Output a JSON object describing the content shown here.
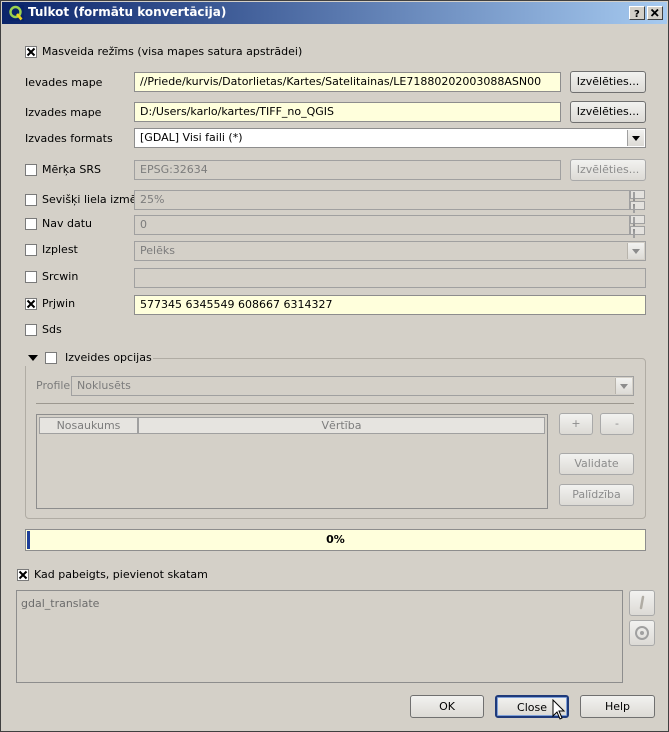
{
  "window": {
    "title": "Tulkot (formātu konvertācija)"
  },
  "batch": {
    "label": "Masveida režīms (visa mapes satura apstrādei)",
    "checked": true
  },
  "input_dir": {
    "label": "Ievades mape",
    "value": "//Priede/kurvis/Datorlietas/Kartes/Satelitainas/LE71880202003088ASN00",
    "button": "Izvēlēties..."
  },
  "output_dir": {
    "label": "Izvades mape",
    "value": "D:/Users/karlo/kartes/TIFF_no_QGIS",
    "button": "Izvēlēties..."
  },
  "output_format": {
    "label": "Izvades formats",
    "value": "[GDAL] Visi faili (*)"
  },
  "target_srs": {
    "label": "Mērķa SRS",
    "value": "EPSG:32634",
    "button": "Izvēlēties...",
    "checked": false
  },
  "outsize": {
    "label": "Sevišķi liela izmēr",
    "value": "25%",
    "checked": false
  },
  "nodata": {
    "label": "Nav datu",
    "value": "0",
    "checked": false
  },
  "expand": {
    "label": "Izplest",
    "value": "Pelēks",
    "checked": false
  },
  "srcwin": {
    "label": "Srcwin",
    "value": "",
    "checked": false
  },
  "prjwin": {
    "label": "Prjwin",
    "value": "577345 6345549 608667 6314327",
    "checked": true
  },
  "sds": {
    "label": "Sds",
    "checked": false
  },
  "creation_options": {
    "title": "Izveides opcijas",
    "checked": false,
    "profile_label": "Profile",
    "profile_value": "Noklusēts",
    "col_name": "Nosaukums",
    "col_value": "Vērtība",
    "add_label": "+",
    "remove_label": "-",
    "validate_label": "Validate",
    "help_label": "Palīdzība"
  },
  "progress": {
    "value": 0,
    "text": "0%"
  },
  "load_when_done": {
    "label": "Kad pabeigts, pievienot skatam",
    "checked": true
  },
  "command": {
    "text": "gdal_translate"
  },
  "buttons": {
    "ok": "OK",
    "close": "Close",
    "help": "Help"
  },
  "colors": {
    "title_start": "#0a246a",
    "title_end": "#a6caf0",
    "input_yellow": "#ffffdc",
    "progress_chunk": "#1f3f9a"
  }
}
